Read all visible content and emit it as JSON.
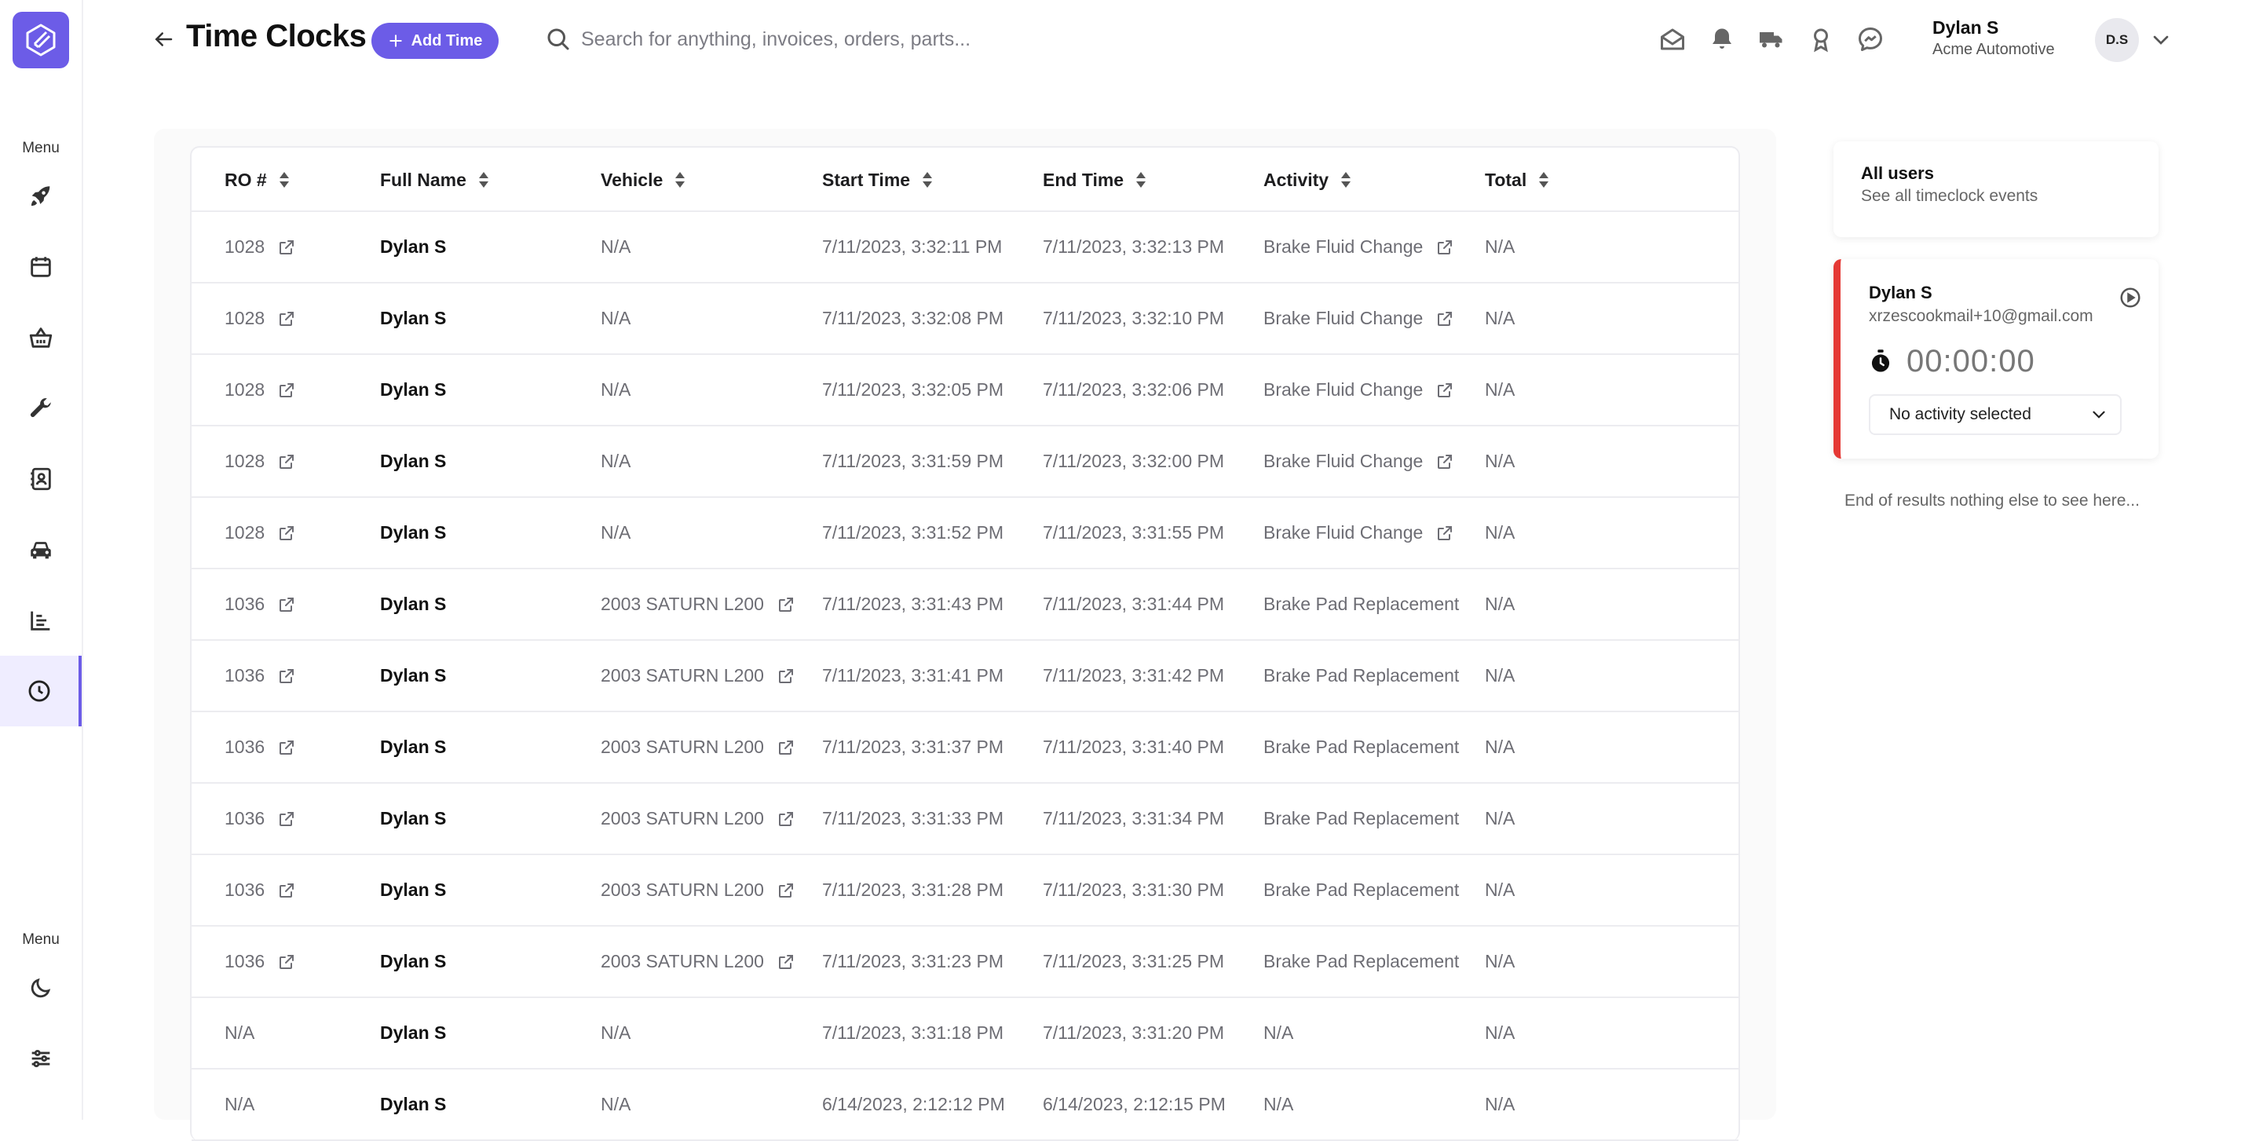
{
  "header": {
    "title": "Time Clocks",
    "add_button": "Add Time",
    "search_placeholder": "Search for anything, invoices, orders, parts...",
    "user_name": "Dylan S",
    "user_company": "Acme Automotive",
    "avatar_initials": "D.S"
  },
  "sidebar": {
    "menu_label_top": "Menu",
    "menu_label_bottom": "Menu",
    "items": [
      "rocket-icon",
      "calendar-icon",
      "basket-icon",
      "wrench-icon",
      "contacts-icon",
      "car-icon",
      "chart-icon",
      "clock-icon"
    ],
    "bottom_items": [
      "moon-icon",
      "sliders-icon"
    ],
    "active_item": "clock-icon",
    "accent_color": "#6c5ce7"
  },
  "table": {
    "columns": [
      "RO #",
      "Full Name",
      "Vehicle",
      "Start Time",
      "End Time",
      "Activity",
      "Total"
    ],
    "rows": [
      {
        "ro": "1028",
        "name": "Dylan S",
        "vehicle": "N/A",
        "start": "7/11/2023, 3:32:11 PM",
        "end": "7/11/2023, 3:32:13 PM",
        "activity": "Brake Fluid Change",
        "total": "N/A"
      },
      {
        "ro": "1028",
        "name": "Dylan S",
        "vehicle": "N/A",
        "start": "7/11/2023, 3:32:08 PM",
        "end": "7/11/2023, 3:32:10 PM",
        "activity": "Brake Fluid Change",
        "total": "N/A"
      },
      {
        "ro": "1028",
        "name": "Dylan S",
        "vehicle": "N/A",
        "start": "7/11/2023, 3:32:05 PM",
        "end": "7/11/2023, 3:32:06 PM",
        "activity": "Brake Fluid Change",
        "total": "N/A"
      },
      {
        "ro": "1028",
        "name": "Dylan S",
        "vehicle": "N/A",
        "start": "7/11/2023, 3:31:59 PM",
        "end": "7/11/2023, 3:32:00 PM",
        "activity": "Brake Fluid Change",
        "total": "N/A"
      },
      {
        "ro": "1028",
        "name": "Dylan S",
        "vehicle": "N/A",
        "start": "7/11/2023, 3:31:52 PM",
        "end": "7/11/2023, 3:31:55 PM",
        "activity": "Brake Fluid Change",
        "total": "N/A"
      },
      {
        "ro": "1036",
        "name": "Dylan S",
        "vehicle": "2003 SATURN L200",
        "start": "7/11/2023, 3:31:43 PM",
        "end": "7/11/2023, 3:31:44 PM",
        "activity": "Brake Pad Replacement",
        "total": "N/A"
      },
      {
        "ro": "1036",
        "name": "Dylan S",
        "vehicle": "2003 SATURN L200",
        "start": "7/11/2023, 3:31:41 PM",
        "end": "7/11/2023, 3:31:42 PM",
        "activity": "Brake Pad Replacement",
        "total": "N/A"
      },
      {
        "ro": "1036",
        "name": "Dylan S",
        "vehicle": "2003 SATURN L200",
        "start": "7/11/2023, 3:31:37 PM",
        "end": "7/11/2023, 3:31:40 PM",
        "activity": "Brake Pad Replacement",
        "total": "N/A"
      },
      {
        "ro": "1036",
        "name": "Dylan S",
        "vehicle": "2003 SATURN L200",
        "start": "7/11/2023, 3:31:33 PM",
        "end": "7/11/2023, 3:31:34 PM",
        "activity": "Brake Pad Replacement",
        "total": "N/A"
      },
      {
        "ro": "1036",
        "name": "Dylan S",
        "vehicle": "2003 SATURN L200",
        "start": "7/11/2023, 3:31:28 PM",
        "end": "7/11/2023, 3:31:30 PM",
        "activity": "Brake Pad Replacement",
        "total": "N/A"
      },
      {
        "ro": "1036",
        "name": "Dylan S",
        "vehicle": "2003 SATURN L200",
        "start": "7/11/2023, 3:31:23 PM",
        "end": "7/11/2023, 3:31:25 PM",
        "activity": "Brake Pad Replacement",
        "total": "N/A"
      },
      {
        "ro": "N/A",
        "name": "Dylan S",
        "vehicle": "N/A",
        "start": "7/11/2023, 3:31:18 PM",
        "end": "7/11/2023, 3:31:20 PM",
        "activity": "N/A",
        "total": "N/A"
      },
      {
        "ro": "N/A",
        "name": "Dylan S",
        "vehicle": "N/A",
        "start": "6/14/2023, 2:12:12 PM",
        "end": "6/14/2023, 2:12:15 PM",
        "activity": "N/A",
        "total": "N/A"
      }
    ]
  },
  "right_panel": {
    "all_users_title": "All users",
    "all_users_subtitle": "See all timeclock events",
    "user_card": {
      "name": "Dylan S",
      "email": "xrzescookmail+10@gmail.com",
      "timer": "00:00:00",
      "activity_select": "No activity selected",
      "status_color": "#e53935"
    },
    "end_text": "End of results nothing else to see here..."
  }
}
